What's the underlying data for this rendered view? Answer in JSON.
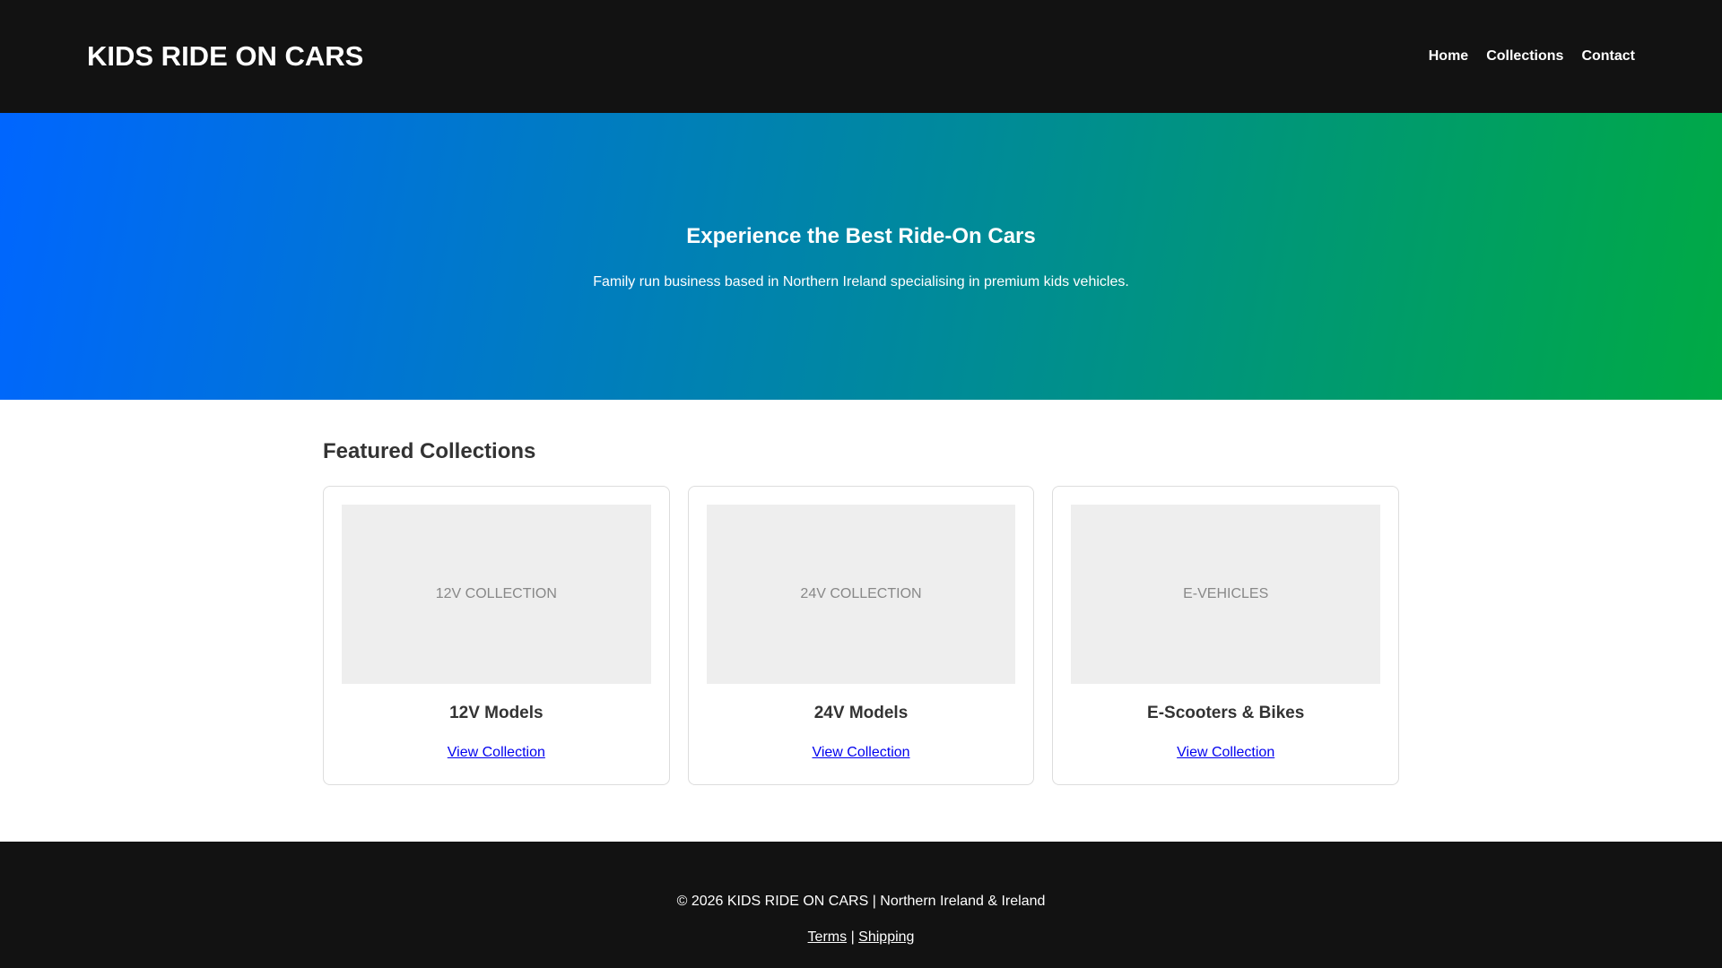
{
  "header": {
    "logo": "KIDS RIDE ON CARS",
    "nav": [
      "Home",
      "Collections",
      "Contact"
    ]
  },
  "hero": {
    "title": "Experience the Best Ride-On Cars",
    "subtitle": "Family run business based in Northern Ireland specialising in premium kids vehicles."
  },
  "featured": {
    "heading": "Featured Collections",
    "cards": [
      {
        "image_label": "12V COLLECTION",
        "title": "12V Models",
        "link": "View Collection"
      },
      {
        "image_label": "24V COLLECTION",
        "title": "24V Models",
        "link": "View Collection"
      },
      {
        "image_label": "E-VEHICLES",
        "title": "E-Scooters & Bikes",
        "link": "View Collection"
      }
    ]
  },
  "footer": {
    "copyright": "© 2026 KIDS RIDE ON CARS | Northern Ireland & Ireland",
    "terms": "Terms",
    "separator": "|",
    "shipping": "Shipping"
  }
}
